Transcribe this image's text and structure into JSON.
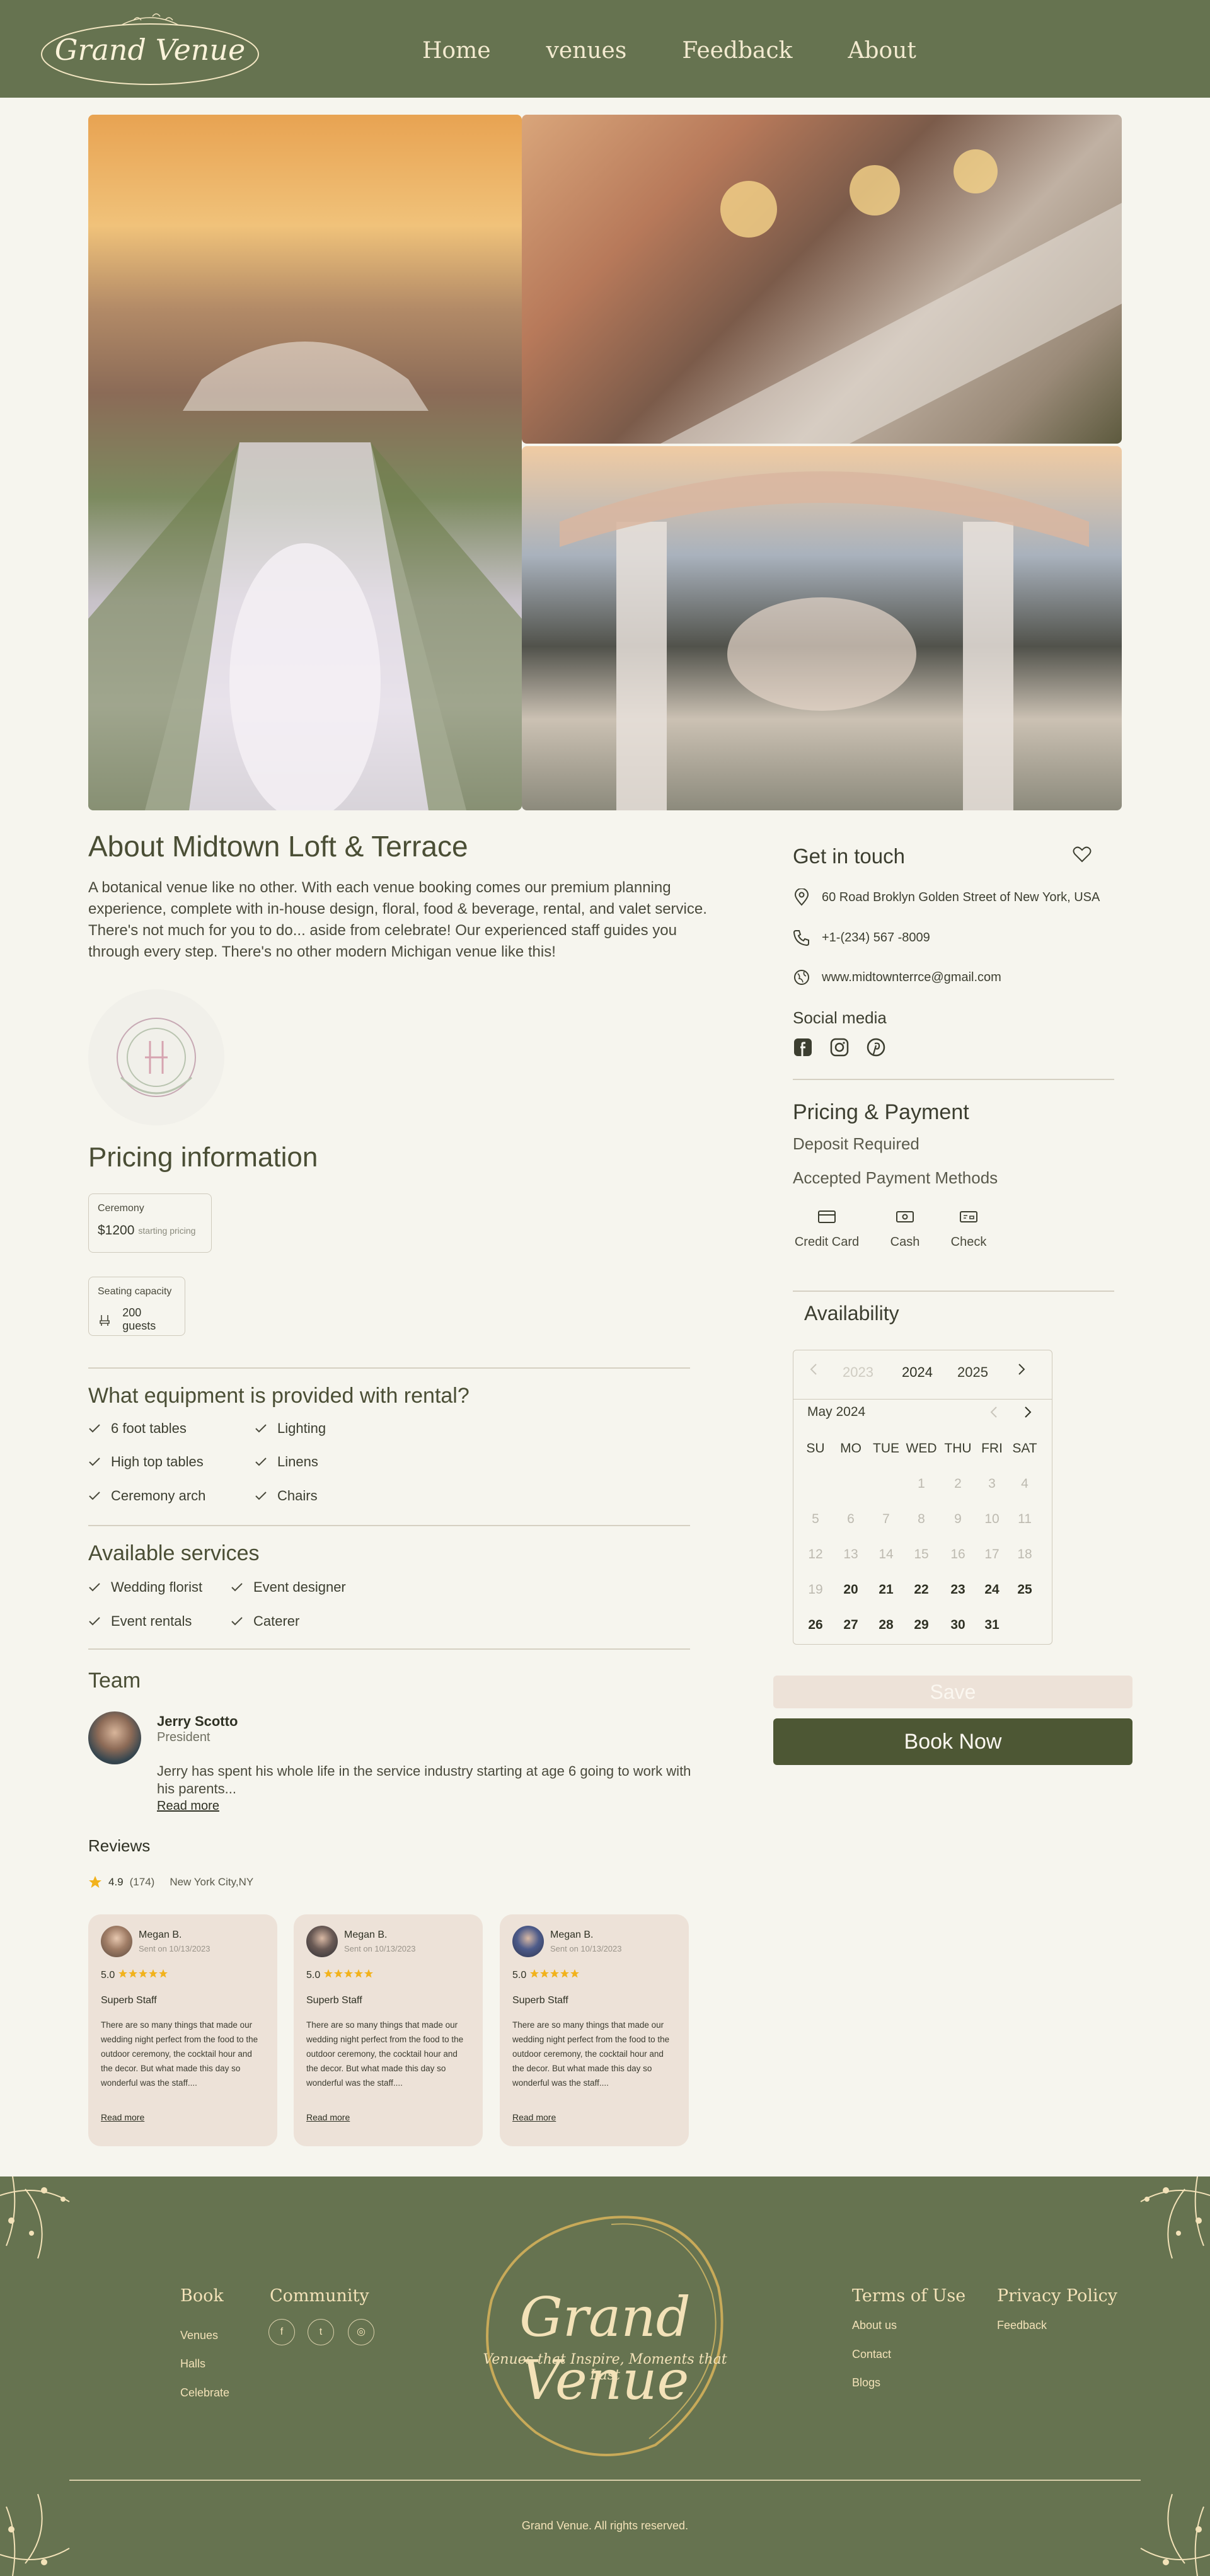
{
  "header": {
    "logo_text": "Grand Venue",
    "nav": [
      "Home",
      "venues",
      "Feedback",
      "About"
    ]
  },
  "about": {
    "title": "About Midtown Loft & Terrace",
    "description": "A botanical venue like no other. With each venue booking comes our premium planning experience, complete with in-house design, floral, food & beverage, rental, and valet service. There's not much for you to do... aside from celebrate! Our experienced staff guides you through every step. There's no other modern Michigan venue like this!"
  },
  "pricing": {
    "title": "Pricing information",
    "ceremony_label": "Ceremony",
    "ceremony_price": "$1200",
    "ceremony_sub": "starting pricing",
    "capacity_label": "Seating capacity",
    "capacity_value": "200 guests"
  },
  "equipment": {
    "title": "What equipment is provided with rental?",
    "items": [
      "6 foot tables",
      "Lighting",
      "High top tables",
      "Linens",
      "Ceremony arch",
      "Chairs"
    ]
  },
  "services": {
    "title": "Available services",
    "items": [
      "Wedding florist",
      "Event designer",
      "Event rentals",
      "Caterer"
    ]
  },
  "team": {
    "title": "Team",
    "name": "Jerry Scotto",
    "role": "President",
    "bio": "Jerry has spent his whole life in the service industry starting at age 6 going to work with his parents...",
    "read_more": "Read more"
  },
  "reviews": {
    "title": "Reviews",
    "rating": "4.9",
    "count": "(174)",
    "location": "New York City,NY",
    "cards": [
      {
        "name": "Megan B.",
        "date": "Sent on 10/13/2023",
        "score": "5.0",
        "title": "Superb Staff",
        "body": "There are so many things that made our wedding night perfect from the food to the outdoor ceremony, the cocktail hour and the decor. But what made this day so wonderful was the staff....",
        "more": "Read more"
      },
      {
        "name": "Megan B.",
        "date": "Sent on 10/13/2023",
        "score": "5.0",
        "title": "Superb Staff",
        "body": "There are so many things that made our wedding night perfect from the food to the outdoor ceremony, the cocktail hour and the decor. But what made this day so wonderful was the staff....",
        "more": "Read more"
      },
      {
        "name": "Megan B.",
        "date": "Sent on 10/13/2023",
        "score": "5.0",
        "title": "Superb Staff",
        "body": "There are so many things that made our wedding night perfect from the food to the outdoor ceremony, the cocktail hour and the decor. But what made this day so wonderful was the staff....",
        "more": "Read more"
      }
    ]
  },
  "contact": {
    "title": "Get in touch",
    "address": "60 Road Broklyn Golden Street of New York, USA",
    "phone": "+1-(234) 567 -8009",
    "website": "www.midtownterrce@gmail.com",
    "social_title": "Social media"
  },
  "payment": {
    "title": "Pricing & Payment",
    "deposit": "Deposit Required",
    "accepted": "Accepted Payment Methods",
    "methods": [
      "Credit Card",
      "Cash",
      "Check"
    ]
  },
  "availability": {
    "title": "Availability",
    "years": [
      "2023",
      "2024",
      "2025"
    ],
    "selected_year": "2024",
    "month": "May 2024",
    "weekdays": [
      "SU",
      "MO",
      "TUE",
      "WED",
      "THU",
      "FRI",
      "SAT"
    ],
    "weeks": [
      [
        "",
        "",
        "",
        "1",
        "2",
        "3",
        "4"
      ],
      [
        "5",
        "6",
        "7",
        "8",
        "9",
        "10",
        "11"
      ],
      [
        "12",
        "13",
        "14",
        "15",
        "16",
        "17",
        "18"
      ],
      [
        "19",
        "20",
        "21",
        "22",
        "23",
        "24",
        "25"
      ],
      [
        "26",
        "27",
        "28",
        "29",
        "30",
        "31",
        ""
      ]
    ],
    "first_available_day": 20
  },
  "actions": {
    "save": "Save",
    "book": "Book Now"
  },
  "footer": {
    "book_title": "Book",
    "book_links": [
      "Venues",
      "Halls",
      "Celebrate"
    ],
    "community_title": "Community",
    "logo_text": "Grand Venue",
    "tagline": "Venues that Inspire, Moments that Last",
    "terms_title": "Terms of Use",
    "terms_links": [
      "About us",
      "Contact",
      "Blogs"
    ],
    "privacy_title": "Privacy Policy",
    "privacy_links": [
      "Feedback"
    ],
    "copyright": "Grand Venue. All rights reserved."
  },
  "colors": {
    "header_bg": "#667350",
    "page_bg": "#f6f5ee",
    "primary_button": "#4d5734",
    "card_bg": "#ede2d8",
    "footer_text": "#f3e2b8",
    "star": "#f2b21c"
  }
}
